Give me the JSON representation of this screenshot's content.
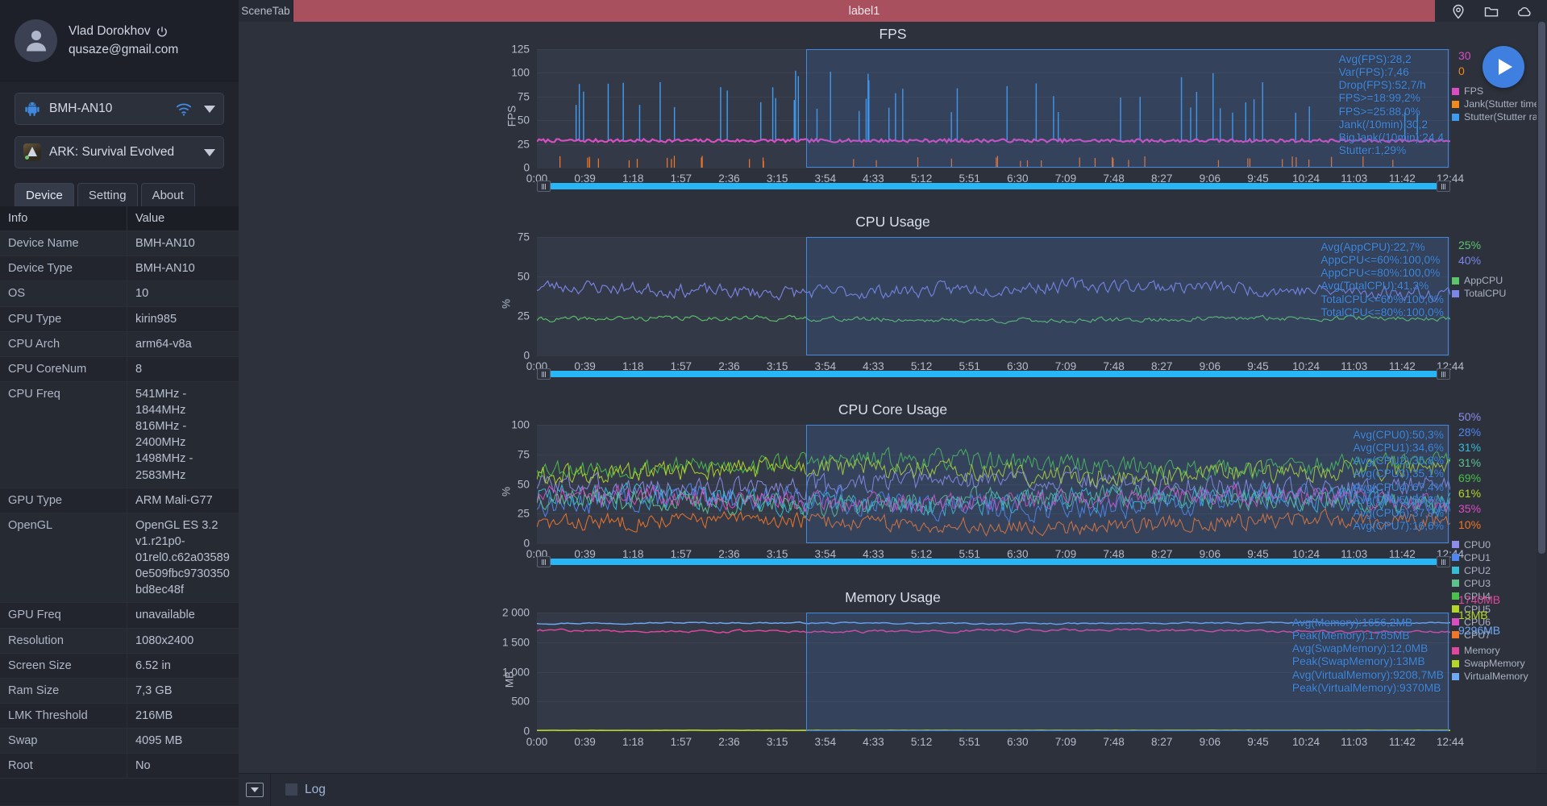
{
  "account": {
    "name": "Vlad Dorokhov",
    "email": "qusaze@gmail.com",
    "power_icon": "power-icon",
    "avatar_icon": "avatar-icon"
  },
  "device_select": {
    "label": "BMH-AN10",
    "lead_icon": "android-icon",
    "status_icon": "wifi-icon",
    "caret_icon": "chevron-down-icon"
  },
  "app_select": {
    "label": "ARK: Survival Evolved",
    "lead_icon": "game-icon",
    "caret_icon": "chevron-down-icon"
  },
  "tabs": [
    {
      "label": "Device",
      "active": true
    },
    {
      "label": "Setting",
      "active": false
    },
    {
      "label": "About",
      "active": false
    }
  ],
  "info_table": {
    "headers": [
      "Info",
      "Value"
    ],
    "rows": [
      [
        "Device Name",
        "BMH-AN10"
      ],
      [
        "Device Type",
        "BMH-AN10"
      ],
      [
        "OS",
        "10"
      ],
      [
        "CPU Type",
        "kirin985"
      ],
      [
        "CPU Arch",
        "arm64-v8a"
      ],
      [
        "CPU CoreNum",
        "8"
      ],
      [
        "CPU Freq",
        "541MHz - 1844MHz 816MHz - 2400MHz 1498MHz - 2583MHz"
      ],
      [
        "GPU Type",
        "ARM Mali-G77"
      ],
      [
        "OpenGL",
        "OpenGL ES 3.2 v1.r21p0-01rel0.c62a035890e509fbc9730350bd8ec48f"
      ],
      [
        "GPU Freq",
        "unavailable"
      ],
      [
        "Resolution",
        "1080x2400"
      ],
      [
        "Screen Size",
        "6.52 in"
      ],
      [
        "Ram Size",
        "7,3 GB"
      ],
      [
        "LMK Threshold",
        "216MB"
      ],
      [
        "Swap",
        "4095 MB"
      ],
      [
        "Root",
        "No"
      ]
    ]
  },
  "topbar": {
    "scene_tab": "SceneTab",
    "label": "label1",
    "label_color": "#a9505f",
    "icons": [
      "location-pin-icon",
      "folder-icon",
      "cloud-icon"
    ]
  },
  "bottombar": {
    "toggle_icon": "chevron-down-icon",
    "log_label": "Log"
  },
  "play_button": {
    "name": "play-button",
    "color": "#3f7fe0"
  },
  "x_ticks": [
    "0:00",
    "0:39",
    "1:18",
    "1:57",
    "2:36",
    "3:15",
    "3:54",
    "4:33",
    "5:12",
    "5:51",
    "6:30",
    "7:09",
    "7:48",
    "8:27",
    "9:06",
    "9:45",
    "10:24",
    "11:03",
    "11:42",
    "12:44"
  ],
  "chart_data": [
    {
      "type": "line",
      "title": "FPS",
      "ylabel": "FPS",
      "ylim": [
        0,
        125
      ],
      "yticks": [
        0,
        25,
        50,
        75,
        100,
        125
      ],
      "xlabel": "",
      "x_ticks": [
        "0:00",
        "0:39",
        "1:18",
        "1:57",
        "2:36",
        "3:15",
        "3:54",
        "4:33",
        "5:12",
        "5:51",
        "6:30",
        "7:09",
        "7:48",
        "8:27",
        "9:06",
        "9:45",
        "10:24",
        "11:03",
        "11:42",
        "12:44"
      ],
      "grid": true,
      "legend_position": "right",
      "annotations": [
        "Avg(FPS):28,2",
        "Var(FPS):7,46",
        "Drop(FPS):52,7/h",
        "FPS>=18:99,2%",
        "FPS>=25:88,0%",
        "Jank(/10min):30,2",
        "BigJank(/10min):24,4",
        "Stutter:1,29%"
      ],
      "current_values": [
        {
          "text": "30",
          "color": "#d94ec4"
        },
        {
          "text": "0",
          "color": "#f08a1e"
        }
      ],
      "series": [
        {
          "name": "FPS",
          "color": "#d94ec4",
          "mean": 28.2,
          "values": [
            27,
            29,
            28,
            30,
            28,
            27,
            29,
            28,
            28,
            30,
            29,
            28,
            28,
            27,
            29,
            28,
            30,
            28,
            29,
            28,
            27,
            29,
            28,
            30,
            28,
            29,
            28,
            27,
            29,
            28,
            30,
            28,
            29,
            28,
            28,
            30,
            29,
            28,
            27,
            29,
            28,
            30,
            28,
            29,
            28,
            27,
            29,
            28,
            30,
            28,
            29,
            28,
            28,
            27,
            29,
            30,
            28,
            29,
            28,
            27,
            29,
            28,
            30,
            28,
            29,
            28,
            27,
            29,
            28,
            30,
            28,
            29,
            28,
            27,
            29,
            28,
            30,
            28,
            29,
            28,
            27,
            29,
            28,
            30,
            28,
            29,
            28,
            27,
            29,
            28,
            30,
            28,
            29,
            28,
            27,
            29,
            28,
            30,
            28,
            29
          ]
        },
        {
          "name": "Jank(Stutter times)",
          "color": "#f08a1e",
          "mean": 0,
          "values": []
        },
        {
          "name": "Stutter(Stutter rate)",
          "color": "#3f9bf0",
          "mean": 0,
          "values": []
        }
      ]
    },
    {
      "type": "line",
      "title": "CPU Usage",
      "ylabel": "%",
      "ylim": [
        0,
        75
      ],
      "yticks": [
        0,
        25,
        50,
        75
      ],
      "grid": true,
      "legend_position": "right",
      "annotations": [
        "Avg(AppCPU):22,7%",
        "AppCPU<=60%:100,0%",
        "AppCPU<=80%:100,0%",
        "Avg(TotalCPU):41,3%",
        "TotalCPU<=60%:100,0%",
        "TotalCPU<=80%:100,0%"
      ],
      "current_values": [
        {
          "text": "25%",
          "color": "#5cc46a"
        },
        {
          "text": "40%",
          "color": "#7b86e8"
        }
      ],
      "series": [
        {
          "name": "AppCPU",
          "color": "#5cc46a",
          "mean": 22.7
        },
        {
          "name": "TotalCPU",
          "color": "#7b86e8",
          "mean": 41.3
        }
      ]
    },
    {
      "type": "line",
      "title": "CPU Core Usage",
      "ylabel": "%",
      "ylim": [
        0,
        100
      ],
      "yticks": [
        0,
        25,
        50,
        75,
        100
      ],
      "grid": true,
      "legend_position": "right",
      "annotations": [
        "Avg(CPU0):50,3%",
        "Avg(CPU1):34,6%",
        "Avg(CPU2):35,8%",
        "Avg(CPU3):35,1%",
        "Avg(CPU4):67,4%",
        "Avg(CPU5):53,6%",
        "Avg(CPU6):37,9%",
        "Avg(CPU7):16,6%"
      ],
      "current_values": [
        {
          "text": "50%",
          "color": "#8d8ce8"
        },
        {
          "text": "28%",
          "color": "#4f86f0"
        },
        {
          "text": "31%",
          "color": "#39bcd8"
        },
        {
          "text": "31%",
          "color": "#5ec28d"
        },
        {
          "text": "69%",
          "color": "#4bc04b"
        },
        {
          "text": "61%",
          "color": "#b4d62b"
        },
        {
          "text": "35%",
          "color": "#d94ec4"
        },
        {
          "text": "10%",
          "color": "#f0762a"
        }
      ],
      "series": [
        {
          "name": "CPU0",
          "color": "#8d8ce8",
          "mean": 50.3
        },
        {
          "name": "CPU1",
          "color": "#4f86f0",
          "mean": 34.6
        },
        {
          "name": "CPU2",
          "color": "#39bcd8",
          "mean": 35.8
        },
        {
          "name": "CPU3",
          "color": "#5ec28d",
          "mean": 35.1
        },
        {
          "name": "CPU4",
          "color": "#4bc04b",
          "mean": 67.4
        },
        {
          "name": "CPU5",
          "color": "#b4d62b",
          "mean": 53.6
        },
        {
          "name": "CPU6",
          "color": "#d94ec4",
          "mean": 37.9
        },
        {
          "name": "CPU7",
          "color": "#f0762a",
          "mean": 16.6
        }
      ]
    },
    {
      "type": "line",
      "title": "Memory Usage",
      "ylabel": "MB",
      "ylim": [
        0,
        2000
      ],
      "yticks": [
        0,
        500,
        1000,
        1500,
        2000
      ],
      "ytick_labels": [
        "0",
        "500",
        "1 000",
        "1 500",
        "2 000"
      ],
      "grid": true,
      "legend_position": "right",
      "annotations": [
        "Avg(Memory):1656,2MB",
        "Peak(Memory):1785MB",
        "Avg(SwapMemory):12,0MB",
        "Peak(SwapMemory):13MB",
        "Avg(VirtualMemory):9208,7MB",
        "Peak(VirtualMemory):9370MB"
      ],
      "current_values": [
        {
          "text": "1740MB",
          "color": "#e0479e"
        },
        {
          "text": "13MB",
          "color": "#b4d62b"
        },
        {
          "text": "9296MB",
          "color": "#6fa8f5"
        }
      ],
      "series": [
        {
          "name": "Memory",
          "color": "#e0479e",
          "mean": 1656.2,
          "peak": 1785
        },
        {
          "name": "SwapMemory",
          "color": "#b4d62b",
          "mean": 12.0,
          "peak": 13
        },
        {
          "name": "VirtualMemory",
          "color": "#6fa8f5",
          "mean": 9208.7,
          "peak": 9370
        }
      ]
    }
  ]
}
